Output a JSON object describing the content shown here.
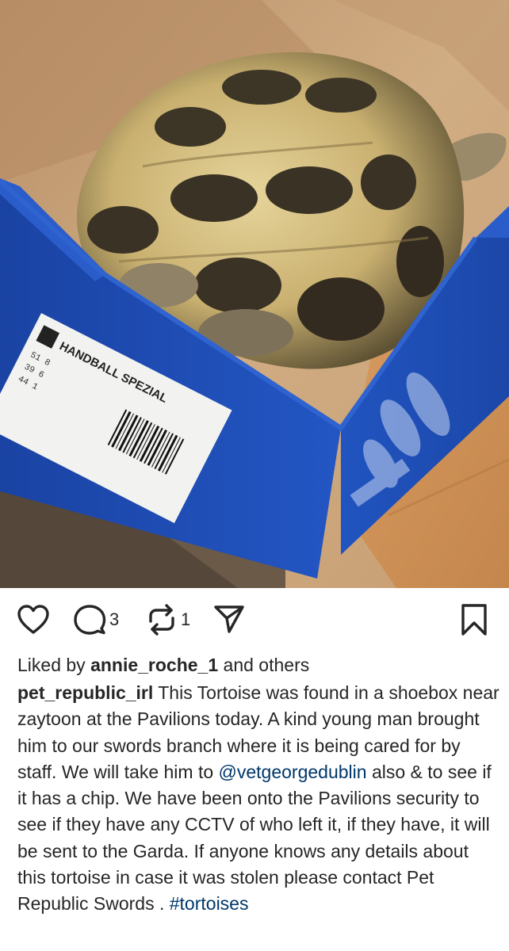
{
  "post": {
    "image_alt": "Tortoise inside a blue shoebox on a cardboard box",
    "actions": {
      "like_icon": "heart-outline-icon",
      "comment_icon": "comment-bubble-icon",
      "comment_count": "3",
      "repost_icon": "repost-arrows-icon",
      "repost_count": "1",
      "share_icon": "paper-plane-icon",
      "save_icon": "bookmark-icon"
    },
    "likes": {
      "prefix": "Liked by ",
      "user": "annie_roche_1",
      "suffix": " and others"
    },
    "caption": {
      "username": "pet_republic_irl",
      "text_part1": " This Tortoise was found in a shoebox near zaytoon at the Pavilions today. A kind young man brought him to our swords branch where it is being cared for by staff. We will take him to ",
      "mention": "@vetgeorgedublin",
      "text_part2": " also & to see if it has a chip. We have been onto the Pavilions security to see if they have any CCTV of who left it, if they have, it will be sent to the Garda. If anyone knows any details about this tortoise in case it was stolen please contact Pet Republic Swords . ",
      "hashtag": "#tortoises"
    },
    "box_label": {
      "line1": "HANDBALL SPEZIAL"
    },
    "colors": {
      "link": "#00376b",
      "text": "#262626",
      "box_blue": "#1f4fb6"
    }
  }
}
